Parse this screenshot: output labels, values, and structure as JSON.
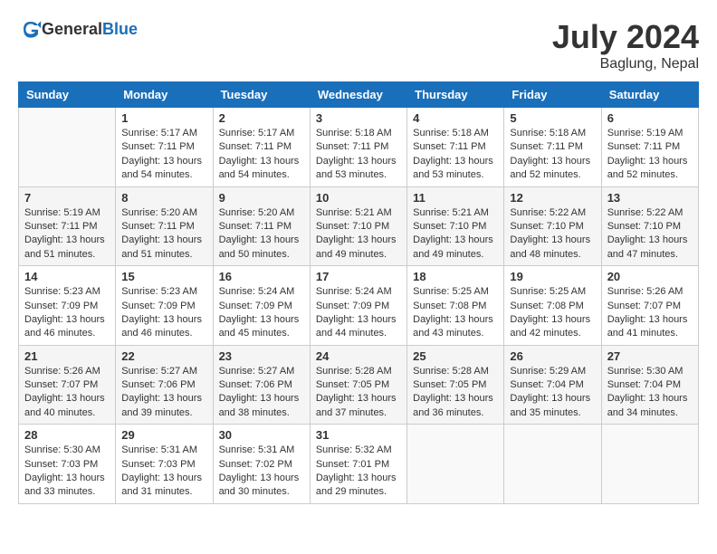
{
  "header": {
    "logo_general": "General",
    "logo_blue": "Blue",
    "month_year": "July 2024",
    "location": "Baglung, Nepal"
  },
  "columns": [
    "Sunday",
    "Monday",
    "Tuesday",
    "Wednesday",
    "Thursday",
    "Friday",
    "Saturday"
  ],
  "weeks": [
    [
      {
        "day": "",
        "sunrise": "",
        "sunset": "",
        "daylight": ""
      },
      {
        "day": "1",
        "sunrise": "Sunrise: 5:17 AM",
        "sunset": "Sunset: 7:11 PM",
        "daylight": "Daylight: 13 hours and 54 minutes."
      },
      {
        "day": "2",
        "sunrise": "Sunrise: 5:17 AM",
        "sunset": "Sunset: 7:11 PM",
        "daylight": "Daylight: 13 hours and 54 minutes."
      },
      {
        "day": "3",
        "sunrise": "Sunrise: 5:18 AM",
        "sunset": "Sunset: 7:11 PM",
        "daylight": "Daylight: 13 hours and 53 minutes."
      },
      {
        "day": "4",
        "sunrise": "Sunrise: 5:18 AM",
        "sunset": "Sunset: 7:11 PM",
        "daylight": "Daylight: 13 hours and 53 minutes."
      },
      {
        "day": "5",
        "sunrise": "Sunrise: 5:18 AM",
        "sunset": "Sunset: 7:11 PM",
        "daylight": "Daylight: 13 hours and 52 minutes."
      },
      {
        "day": "6",
        "sunrise": "Sunrise: 5:19 AM",
        "sunset": "Sunset: 7:11 PM",
        "daylight": "Daylight: 13 hours and 52 minutes."
      }
    ],
    [
      {
        "day": "7",
        "sunrise": "Sunrise: 5:19 AM",
        "sunset": "Sunset: 7:11 PM",
        "daylight": "Daylight: 13 hours and 51 minutes."
      },
      {
        "day": "8",
        "sunrise": "Sunrise: 5:20 AM",
        "sunset": "Sunset: 7:11 PM",
        "daylight": "Daylight: 13 hours and 51 minutes."
      },
      {
        "day": "9",
        "sunrise": "Sunrise: 5:20 AM",
        "sunset": "Sunset: 7:11 PM",
        "daylight": "Daylight: 13 hours and 50 minutes."
      },
      {
        "day": "10",
        "sunrise": "Sunrise: 5:21 AM",
        "sunset": "Sunset: 7:10 PM",
        "daylight": "Daylight: 13 hours and 49 minutes."
      },
      {
        "day": "11",
        "sunrise": "Sunrise: 5:21 AM",
        "sunset": "Sunset: 7:10 PM",
        "daylight": "Daylight: 13 hours and 49 minutes."
      },
      {
        "day": "12",
        "sunrise": "Sunrise: 5:22 AM",
        "sunset": "Sunset: 7:10 PM",
        "daylight": "Daylight: 13 hours and 48 minutes."
      },
      {
        "day": "13",
        "sunrise": "Sunrise: 5:22 AM",
        "sunset": "Sunset: 7:10 PM",
        "daylight": "Daylight: 13 hours and 47 minutes."
      }
    ],
    [
      {
        "day": "14",
        "sunrise": "Sunrise: 5:23 AM",
        "sunset": "Sunset: 7:09 PM",
        "daylight": "Daylight: 13 hours and 46 minutes."
      },
      {
        "day": "15",
        "sunrise": "Sunrise: 5:23 AM",
        "sunset": "Sunset: 7:09 PM",
        "daylight": "Daylight: 13 hours and 46 minutes."
      },
      {
        "day": "16",
        "sunrise": "Sunrise: 5:24 AM",
        "sunset": "Sunset: 7:09 PM",
        "daylight": "Daylight: 13 hours and 45 minutes."
      },
      {
        "day": "17",
        "sunrise": "Sunrise: 5:24 AM",
        "sunset": "Sunset: 7:09 PM",
        "daylight": "Daylight: 13 hours and 44 minutes."
      },
      {
        "day": "18",
        "sunrise": "Sunrise: 5:25 AM",
        "sunset": "Sunset: 7:08 PM",
        "daylight": "Daylight: 13 hours and 43 minutes."
      },
      {
        "day": "19",
        "sunrise": "Sunrise: 5:25 AM",
        "sunset": "Sunset: 7:08 PM",
        "daylight": "Daylight: 13 hours and 42 minutes."
      },
      {
        "day": "20",
        "sunrise": "Sunrise: 5:26 AM",
        "sunset": "Sunset: 7:07 PM",
        "daylight": "Daylight: 13 hours and 41 minutes."
      }
    ],
    [
      {
        "day": "21",
        "sunrise": "Sunrise: 5:26 AM",
        "sunset": "Sunset: 7:07 PM",
        "daylight": "Daylight: 13 hours and 40 minutes."
      },
      {
        "day": "22",
        "sunrise": "Sunrise: 5:27 AM",
        "sunset": "Sunset: 7:06 PM",
        "daylight": "Daylight: 13 hours and 39 minutes."
      },
      {
        "day": "23",
        "sunrise": "Sunrise: 5:27 AM",
        "sunset": "Sunset: 7:06 PM",
        "daylight": "Daylight: 13 hours and 38 minutes."
      },
      {
        "day": "24",
        "sunrise": "Sunrise: 5:28 AM",
        "sunset": "Sunset: 7:05 PM",
        "daylight": "Daylight: 13 hours and 37 minutes."
      },
      {
        "day": "25",
        "sunrise": "Sunrise: 5:28 AM",
        "sunset": "Sunset: 7:05 PM",
        "daylight": "Daylight: 13 hours and 36 minutes."
      },
      {
        "day": "26",
        "sunrise": "Sunrise: 5:29 AM",
        "sunset": "Sunset: 7:04 PM",
        "daylight": "Daylight: 13 hours and 35 minutes."
      },
      {
        "day": "27",
        "sunrise": "Sunrise: 5:30 AM",
        "sunset": "Sunset: 7:04 PM",
        "daylight": "Daylight: 13 hours and 34 minutes."
      }
    ],
    [
      {
        "day": "28",
        "sunrise": "Sunrise: 5:30 AM",
        "sunset": "Sunset: 7:03 PM",
        "daylight": "Daylight: 13 hours and 33 minutes."
      },
      {
        "day": "29",
        "sunrise": "Sunrise: 5:31 AM",
        "sunset": "Sunset: 7:03 PM",
        "daylight": "Daylight: 13 hours and 31 minutes."
      },
      {
        "day": "30",
        "sunrise": "Sunrise: 5:31 AM",
        "sunset": "Sunset: 7:02 PM",
        "daylight": "Daylight: 13 hours and 30 minutes."
      },
      {
        "day": "31",
        "sunrise": "Sunrise: 5:32 AM",
        "sunset": "Sunset: 7:01 PM",
        "daylight": "Daylight: 13 hours and 29 minutes."
      },
      {
        "day": "",
        "sunrise": "",
        "sunset": "",
        "daylight": ""
      },
      {
        "day": "",
        "sunrise": "",
        "sunset": "",
        "daylight": ""
      },
      {
        "day": "",
        "sunrise": "",
        "sunset": "",
        "daylight": ""
      }
    ]
  ]
}
